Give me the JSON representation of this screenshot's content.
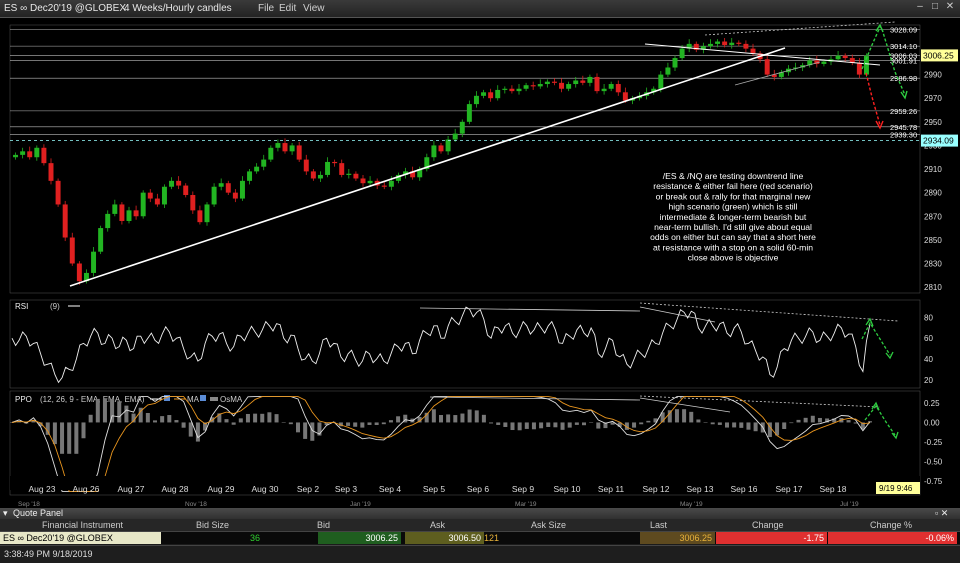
{
  "window": {
    "symbol": "ES ∞ Dec20'19 @GLOBEX",
    "period": "4 Weeks/Hourly candles",
    "menu": [
      "File",
      "Edit",
      "View"
    ]
  },
  "annotation": "/ES  & /NQ are testing downtrend line resistance & either fail here (red scenario) or break out & rally for that marginal new high scenario (green) which is still intermediate & longer-term bearish but near-term bullish. I'd still give about equal odds on either but can say that a short here at resistance with a stop on a solid 60-min close above is objective",
  "colors": {
    "up": "#22b522",
    "down": "#e02020",
    "accent_yellow": "#ffff99",
    "last_price_bg": "#ffff99",
    "support_bg": "#9ff",
    "ema": "#e0e0e0",
    "ma": "#e8951e"
  },
  "chart_data": [
    {
      "type": "candlestick",
      "name": "price",
      "ylim": [
        2805,
        3032
      ],
      "y_ticks": [
        2810,
        2830,
        2850,
        2870,
        2890,
        2910,
        2930,
        2950,
        2970,
        2990
      ],
      "level_labels": [
        "3028.09",
        "3014.10",
        "3006.03",
        "3001.91",
        "2986.98",
        "2959.26",
        "2945.78",
        "2939.30"
      ],
      "levels": [
        3028.09,
        3014.1,
        3006.03,
        3001.91,
        2986.98,
        2959.26,
        2945.78,
        2939.3
      ],
      "last_price": "3006.25",
      "support_price": "2934.09",
      "x_labels": [
        "Aug 23",
        "Aug 26",
        "Aug 27",
        "Aug 28",
        "Aug 29",
        "Aug 30",
        "Sep 2",
        "Sep 3",
        "Sep 4",
        "Sep 5",
        "Sep 6",
        "Sep 9",
        "Sep 10",
        "Sep 11",
        "Sep 12",
        "Sep 13",
        "Sep 16",
        "Sep 17",
        "Sep 18"
      ],
      "lower_scale_labels": [
        "Sep '18",
        "Nov '18",
        "Jan '19",
        "Mar '19",
        "May '19",
        "Jul '19"
      ],
      "cursor_label": "9/19 9:46",
      "closes": [
        2922,
        2925,
        2920,
        2928,
        2915,
        2900,
        2880,
        2852,
        2830,
        2815,
        2822,
        2840,
        2860,
        2872,
        2880,
        2866,
        2875,
        2870,
        2890,
        2885,
        2880,
        2895,
        2900,
        2896,
        2888,
        2875,
        2865,
        2880,
        2895,
        2898,
        2890,
        2885,
        2900,
        2908,
        2912,
        2918,
        2928,
        2932,
        2925,
        2930,
        2918,
        2908,
        2902,
        2905,
        2916,
        2915,
        2905,
        2906,
        2902,
        2898,
        2900,
        2896,
        2895,
        2900,
        2905,
        2908,
        2903,
        2910,
        2920,
        2930,
        2925,
        2935,
        2940,
        2950,
        2965,
        2972,
        2975,
        2970,
        2977,
        2978,
        2976,
        2978,
        2981,
        2980,
        2982,
        2984,
        2983,
        2978,
        2982,
        2985,
        2983,
        2988,
        2976,
        2978,
        2982,
        2975,
        2968,
        2970,
        2972,
        2975,
        2978,
        2990,
        2996,
        3004,
        3012,
        3016,
        3011,
        3014,
        3016,
        3018,
        3015,
        3017,
        3016,
        3012,
        3008,
        3003,
        2990,
        2988,
        2992,
        2995,
        2996,
        2998,
        3002,
        2999,
        3001,
        3003,
        3006,
        3004,
        3000,
        2990,
        3006
      ]
    },
    {
      "type": "line",
      "name": "RSI",
      "params": "(9)",
      "ylim": [
        15,
        92
      ],
      "y_ticks": [
        20,
        40,
        60,
        80
      ],
      "values": [
        60,
        58,
        62,
        55,
        45,
        35,
        25,
        22,
        30,
        40,
        55,
        62,
        65,
        55,
        60,
        52,
        58,
        50,
        62,
        60,
        58,
        64,
        66,
        60,
        50,
        42,
        38,
        55,
        62,
        64,
        55,
        52,
        62,
        65,
        66,
        68,
        72,
        74,
        60,
        63,
        50,
        40,
        38,
        45,
        60,
        55,
        42,
        45,
        40,
        38,
        45,
        40,
        38,
        45,
        52,
        55,
        45,
        58,
        65,
        72,
        60,
        72,
        76,
        82,
        88,
        85,
        78,
        60,
        70,
        72,
        65,
        68,
        72,
        68,
        70,
        72,
        68,
        55,
        62,
        68,
        65,
        70,
        45,
        50,
        58,
        42,
        35,
        40,
        45,
        50,
        55,
        65,
        72,
        78,
        85,
        86,
        70,
        72,
        72,
        74,
        65,
        70,
        66,
        55,
        48,
        42,
        25,
        32,
        50,
        58,
        60,
        62,
        66,
        58,
        62,
        65,
        70,
        64,
        52,
        28,
        74
      ]
    },
    {
      "type": "line",
      "name": "PPO",
      "params": "(12, 26, 9 - EMA, EMA, EMA)",
      "legend": [
        "MA",
        "OsMA"
      ],
      "ylim": [
        -0.9,
        0.35
      ],
      "y_ticks": [
        0.25,
        0.0,
        -0.25,
        -0.5,
        -0.75
      ],
      "y_tick_labels": [
        "0.25",
        "0.00",
        "-0.25",
        "-0.50",
        "-0.75"
      ]
    }
  ],
  "quote_panel": {
    "title": "Quote Panel",
    "columns": [
      "Financial Instrument",
      "Bid Size",
      "Bid",
      "Ask",
      "Ask Size",
      "Last",
      "Change",
      "Change %"
    ],
    "row": {
      "instrument": "ES ∞ Dec20'19 @GLOBEX",
      "bid_size": "36",
      "bid": "3006.25",
      "ask": "3006.50",
      "ask_size": "121",
      "last": "3006.25",
      "change": "-1.75",
      "change_pct": "-0.06%"
    }
  },
  "status": {
    "time": "3:38:49 PM 9/18/2019"
  }
}
